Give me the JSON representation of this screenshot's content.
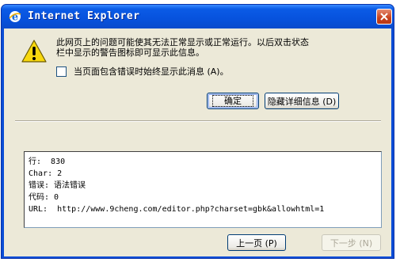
{
  "window": {
    "title": "Internet Explorer"
  },
  "message": {
    "line1": "此网页上的问题可能使其无法正常显示或正常运行。以后双击状态",
    "line2": "栏中显示的警告图标即可显示此信息。"
  },
  "checkbox": {
    "label": "当页面包含错误时始终显示此消息 (A)。",
    "checked": false
  },
  "buttons": {
    "ok": "确定",
    "hide_details": "隐藏详细信息 (D)",
    "prev": "上一页 (P)",
    "next": "下一步 (N)"
  },
  "details": {
    "lines": [
      "行:  830",
      "Char: 2",
      "错误: 语法错误",
      "代码: 0",
      "URL:  http://www.9cheng.com/editor.php?charset=gbk&allowhtml=1"
    ]
  },
  "icons": {
    "title": "ie-logo-icon",
    "warning": "warning-icon",
    "close": "close-icon"
  },
  "colors": {
    "titlebar": "#0a4bcc",
    "close_button": "#c7401c",
    "warning": "#f8d80e"
  }
}
